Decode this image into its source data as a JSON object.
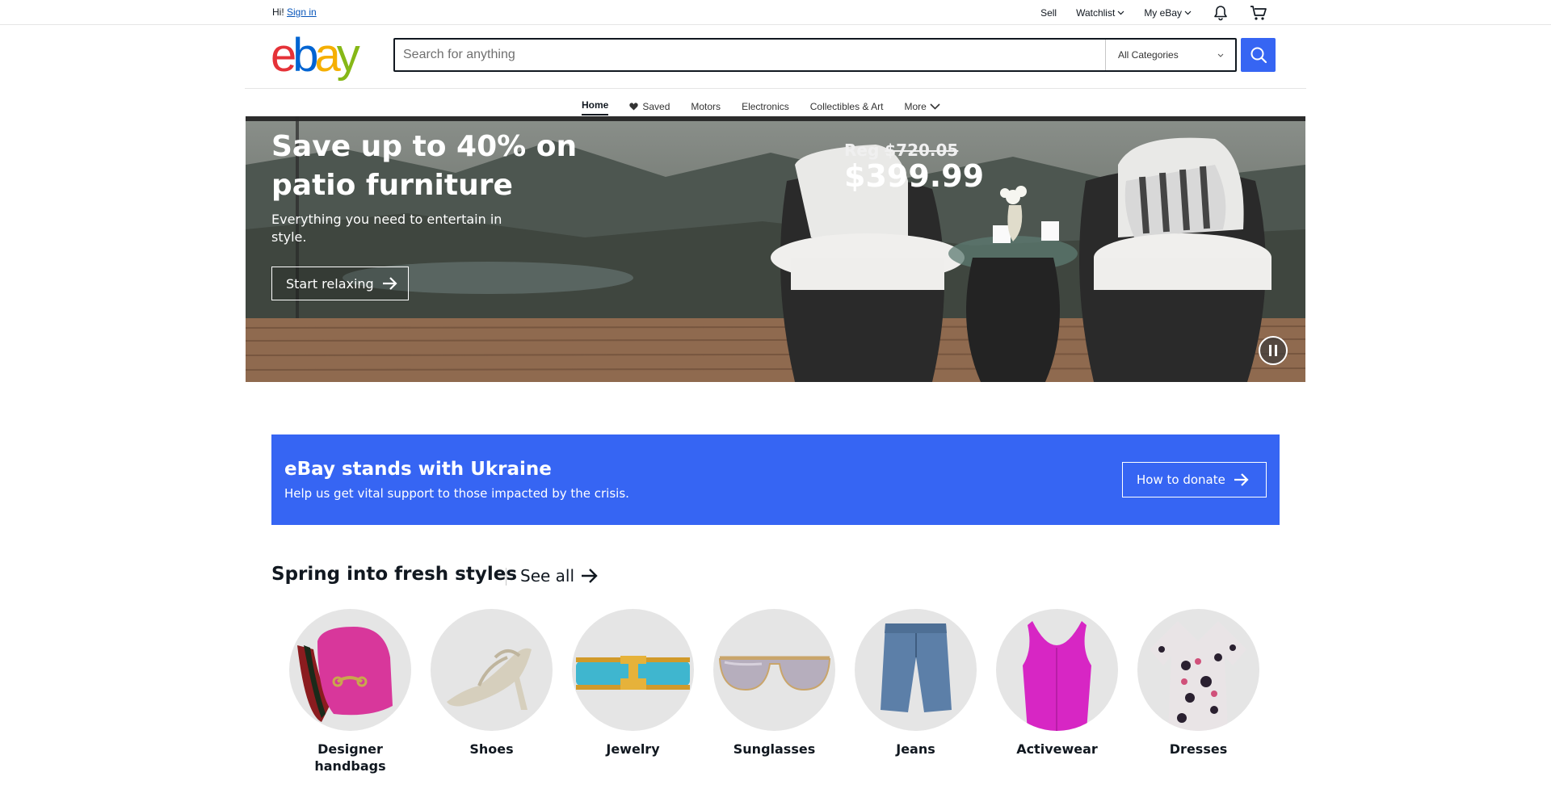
{
  "topbar": {
    "greeting": "Hi!",
    "sign_in": "Sign in",
    "sell": "Sell",
    "watchlist": "Watchlist",
    "my_ebay": "My eBay",
    "notifications_icon": "bell-icon",
    "cart_icon": "cart-icon"
  },
  "header": {
    "logo": [
      "e",
      "b",
      "a",
      "y"
    ],
    "search_placeholder": "Search for anything",
    "category_selected": "All Categories",
    "search_icon": "search-icon"
  },
  "nav": {
    "items": [
      {
        "label": "Home",
        "active": true
      },
      {
        "label": "Saved",
        "icon": "heart-icon"
      },
      {
        "label": "Motors"
      },
      {
        "label": "Electronics"
      },
      {
        "label": "Collectibles & Art"
      },
      {
        "label": "More",
        "icon": "chevron-down-icon"
      }
    ]
  },
  "hero": {
    "title": "Save up to 40% on patio furniture",
    "subtitle": "Everything you need to entertain in style.",
    "cta": "Start relaxing",
    "reg_label": "Reg",
    "reg_price": "$720.05",
    "sale_price": "$399.99",
    "pause_icon": "pause-icon"
  },
  "ukraine": {
    "title": "eBay stands with Ukraine",
    "text": "Help us get vital support to those impacted by the crisis.",
    "cta": "How to donate"
  },
  "spring": {
    "title": "Spring into fresh styles",
    "see_all": "See all",
    "categories": [
      {
        "label": "Designer handbags"
      },
      {
        "label": "Shoes"
      },
      {
        "label": "Jewelry"
      },
      {
        "label": "Sunglasses"
      },
      {
        "label": "Jeans"
      },
      {
        "label": "Activewear"
      },
      {
        "label": "Dresses"
      }
    ]
  },
  "colors": {
    "accent_blue": "#3665f3",
    "link_blue": "#0654ba",
    "logo_red": "#e53238",
    "logo_blue": "#0064d2",
    "logo_yellow": "#f5af02",
    "logo_green": "#86b817",
    "text": "#111820"
  }
}
